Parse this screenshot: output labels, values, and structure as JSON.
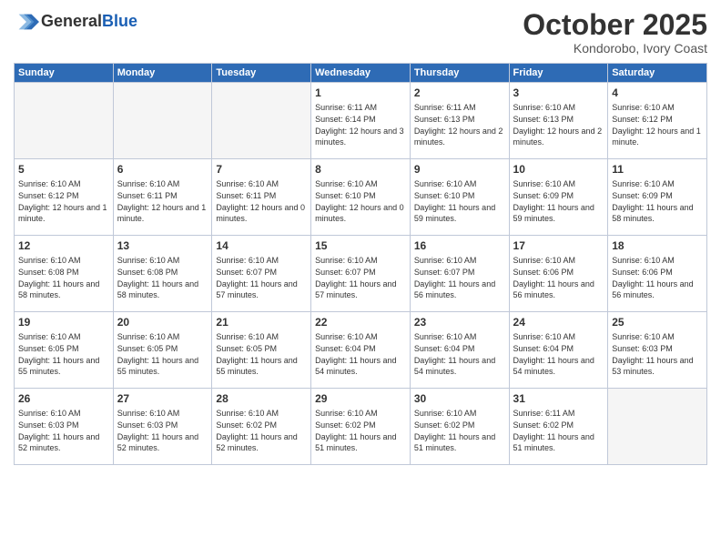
{
  "header": {
    "logo_line1": "General",
    "logo_line2": "Blue",
    "month": "October 2025",
    "location": "Kondorobo, Ivory Coast"
  },
  "weekdays": [
    "Sunday",
    "Monday",
    "Tuesday",
    "Wednesday",
    "Thursday",
    "Friday",
    "Saturday"
  ],
  "weeks": [
    [
      {
        "day": "",
        "info": ""
      },
      {
        "day": "",
        "info": ""
      },
      {
        "day": "",
        "info": ""
      },
      {
        "day": "1",
        "info": "Sunrise: 6:11 AM\nSunset: 6:14 PM\nDaylight: 12 hours and 3 minutes."
      },
      {
        "day": "2",
        "info": "Sunrise: 6:11 AM\nSunset: 6:13 PM\nDaylight: 12 hours and 2 minutes."
      },
      {
        "day": "3",
        "info": "Sunrise: 6:10 AM\nSunset: 6:13 PM\nDaylight: 12 hours and 2 minutes."
      },
      {
        "day": "4",
        "info": "Sunrise: 6:10 AM\nSunset: 6:12 PM\nDaylight: 12 hours and 1 minute."
      }
    ],
    [
      {
        "day": "5",
        "info": "Sunrise: 6:10 AM\nSunset: 6:12 PM\nDaylight: 12 hours and 1 minute."
      },
      {
        "day": "6",
        "info": "Sunrise: 6:10 AM\nSunset: 6:11 PM\nDaylight: 12 hours and 1 minute."
      },
      {
        "day": "7",
        "info": "Sunrise: 6:10 AM\nSunset: 6:11 PM\nDaylight: 12 hours and 0 minutes."
      },
      {
        "day": "8",
        "info": "Sunrise: 6:10 AM\nSunset: 6:10 PM\nDaylight: 12 hours and 0 minutes."
      },
      {
        "day": "9",
        "info": "Sunrise: 6:10 AM\nSunset: 6:10 PM\nDaylight: 11 hours and 59 minutes."
      },
      {
        "day": "10",
        "info": "Sunrise: 6:10 AM\nSunset: 6:09 PM\nDaylight: 11 hours and 59 minutes."
      },
      {
        "day": "11",
        "info": "Sunrise: 6:10 AM\nSunset: 6:09 PM\nDaylight: 11 hours and 58 minutes."
      }
    ],
    [
      {
        "day": "12",
        "info": "Sunrise: 6:10 AM\nSunset: 6:08 PM\nDaylight: 11 hours and 58 minutes."
      },
      {
        "day": "13",
        "info": "Sunrise: 6:10 AM\nSunset: 6:08 PM\nDaylight: 11 hours and 58 minutes."
      },
      {
        "day": "14",
        "info": "Sunrise: 6:10 AM\nSunset: 6:07 PM\nDaylight: 11 hours and 57 minutes."
      },
      {
        "day": "15",
        "info": "Sunrise: 6:10 AM\nSunset: 6:07 PM\nDaylight: 11 hours and 57 minutes."
      },
      {
        "day": "16",
        "info": "Sunrise: 6:10 AM\nSunset: 6:07 PM\nDaylight: 11 hours and 56 minutes."
      },
      {
        "day": "17",
        "info": "Sunrise: 6:10 AM\nSunset: 6:06 PM\nDaylight: 11 hours and 56 minutes."
      },
      {
        "day": "18",
        "info": "Sunrise: 6:10 AM\nSunset: 6:06 PM\nDaylight: 11 hours and 56 minutes."
      }
    ],
    [
      {
        "day": "19",
        "info": "Sunrise: 6:10 AM\nSunset: 6:05 PM\nDaylight: 11 hours and 55 minutes."
      },
      {
        "day": "20",
        "info": "Sunrise: 6:10 AM\nSunset: 6:05 PM\nDaylight: 11 hours and 55 minutes."
      },
      {
        "day": "21",
        "info": "Sunrise: 6:10 AM\nSunset: 6:05 PM\nDaylight: 11 hours and 55 minutes."
      },
      {
        "day": "22",
        "info": "Sunrise: 6:10 AM\nSunset: 6:04 PM\nDaylight: 11 hours and 54 minutes."
      },
      {
        "day": "23",
        "info": "Sunrise: 6:10 AM\nSunset: 6:04 PM\nDaylight: 11 hours and 54 minutes."
      },
      {
        "day": "24",
        "info": "Sunrise: 6:10 AM\nSunset: 6:04 PM\nDaylight: 11 hours and 54 minutes."
      },
      {
        "day": "25",
        "info": "Sunrise: 6:10 AM\nSunset: 6:03 PM\nDaylight: 11 hours and 53 minutes."
      }
    ],
    [
      {
        "day": "26",
        "info": "Sunrise: 6:10 AM\nSunset: 6:03 PM\nDaylight: 11 hours and 52 minutes."
      },
      {
        "day": "27",
        "info": "Sunrise: 6:10 AM\nSunset: 6:03 PM\nDaylight: 11 hours and 52 minutes."
      },
      {
        "day": "28",
        "info": "Sunrise: 6:10 AM\nSunset: 6:02 PM\nDaylight: 11 hours and 52 minutes."
      },
      {
        "day": "29",
        "info": "Sunrise: 6:10 AM\nSunset: 6:02 PM\nDaylight: 11 hours and 51 minutes."
      },
      {
        "day": "30",
        "info": "Sunrise: 6:10 AM\nSunset: 6:02 PM\nDaylight: 11 hours and 51 minutes."
      },
      {
        "day": "31",
        "info": "Sunrise: 6:11 AM\nSunset: 6:02 PM\nDaylight: 11 hours and 51 minutes."
      },
      {
        "day": "",
        "info": ""
      }
    ]
  ]
}
